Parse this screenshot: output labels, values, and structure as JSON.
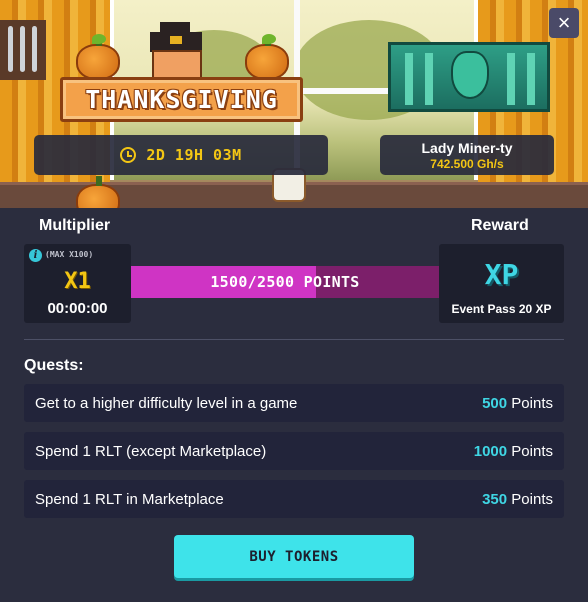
{
  "event": {
    "title": "THANKSGIVING",
    "timer": "2D 19H 03M",
    "miner_name": "Lady Miner-ty",
    "miner_power": "742.500 Gh/s"
  },
  "close_label": "×",
  "multiplier": {
    "label": "Multiplier",
    "max_text": "(MAX X100)",
    "value": "X1",
    "time": "00:00:00",
    "info_icon": "i"
  },
  "progress": {
    "text": "1500/2500 POINTS",
    "current": 1500,
    "total": 2500
  },
  "reward": {
    "label": "Reward",
    "icon_text": "XP",
    "name": "Event Pass 20 XP"
  },
  "quests": {
    "label": "Quests:",
    "unit": "Points",
    "items": [
      {
        "name": "Get to a higher difficulty level in a game",
        "points": "500"
      },
      {
        "name": "Spend 1 RLT (except Marketplace)",
        "points": "1000"
      },
      {
        "name": "Spend 1 RLT in Marketplace",
        "points": "350"
      }
    ]
  },
  "buy_button": "BUY TOKENS",
  "colors": {
    "background": "#2b2d3e",
    "accent_cyan": "#3fd6e4",
    "accent_yellow": "#f3c614",
    "progress_fill": "#cf34c4",
    "progress_track": "#7c1f6a"
  }
}
